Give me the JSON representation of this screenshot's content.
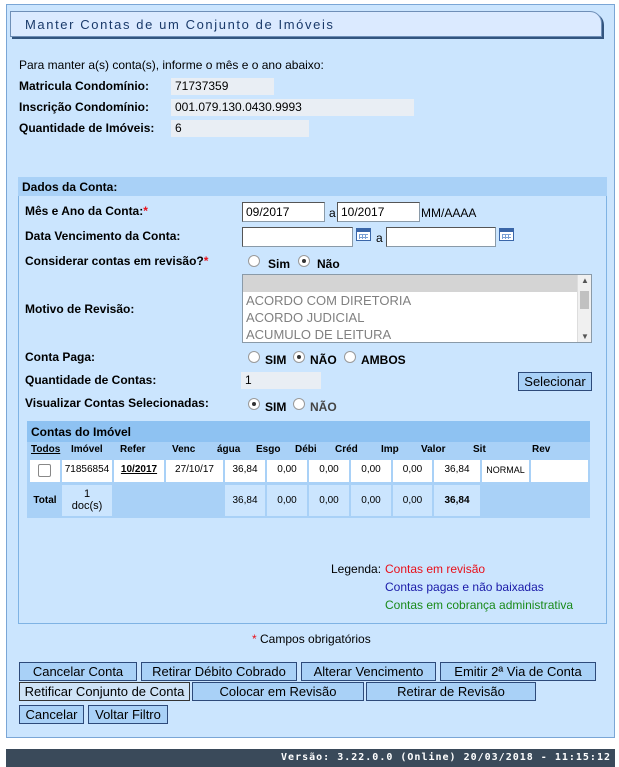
{
  "title": "Manter Contas de um Conjunto de Imóveis",
  "intro": "Para manter a(s) conta(s), informe o mês e o ano abaixo:",
  "info": {
    "matricula_label": "Matricula Condomínio:",
    "matricula_value": "71737359",
    "inscricao_label": "Inscrição Condomínio:",
    "inscricao_value": "001.079.130.0430.9993",
    "qtd_imoveis_label": "Quantidade de Imóveis:",
    "qtd_imoveis_value": "6"
  },
  "dados": {
    "header": "Dados da Conta:",
    "mes_ano_label": "Mês e Ano da Conta:",
    "mes_ano_from": "09/2017",
    "mes_ano_sep": "a",
    "mes_ano_to": "10/2017",
    "mes_ano_format": "MM/AAAA",
    "venc_label": "Data Vencimento da Conta:",
    "venc_sep": "a",
    "revisao_label": "Considerar contas em revisão?",
    "revisao_options": [
      "Sim",
      "Não"
    ],
    "revisao_selected": "Não",
    "motivo_label": "Motivo de Revisão:",
    "motivo_options": [
      "ACORDO COM DIRETORIA",
      "ACORDO JUDICIAL",
      "ACUMULO DE LEITURA"
    ],
    "paga_label": "Conta Paga:",
    "paga_options": [
      "SIM",
      "NÃO",
      "AMBOS"
    ],
    "paga_selected": "NÃO",
    "qtd_contas_label": "Quantidade de Contas:",
    "qtd_contas_value": "1",
    "selecionar_button": "Selecionar",
    "visualizar_label": "Visualizar Contas Selecionadas:",
    "visualizar_options": [
      "SIM",
      "NÃO"
    ],
    "visualizar_selected": "SIM",
    "required_mark": "*"
  },
  "contas": {
    "header": "Contas do Imóvel",
    "columns": [
      "Todos",
      "Imóvel",
      "Refer",
      "Venc",
      "água",
      "Esgo",
      "Débi",
      "Créd",
      "Imp",
      "Valor",
      "Sit",
      "Rev"
    ],
    "row": {
      "imovel": "71856854",
      "refer": "10/2017",
      "venc": "27/10/17",
      "agua": "36,84",
      "esgo": "0,00",
      "debi": "0,00",
      "cred": "0,00",
      "imp": "0,00",
      "valor": "36,84",
      "sit": "NORMAL",
      "rev": ""
    },
    "total": {
      "label": "Total",
      "docs_count": "1",
      "docs_unit": "doc(s)",
      "agua": "36,84",
      "esgo": "0,00",
      "debi": "0,00",
      "cred": "0,00",
      "imp": "0,00",
      "valor": "36,84"
    }
  },
  "legenda": {
    "label": "Legenda:",
    "items": [
      {
        "text": "Contas em revisão",
        "color": "#e8101a"
      },
      {
        "text": "Contas pagas e não baixadas",
        "color": "#1a1aa8"
      },
      {
        "text": "Contas em cobrança administrativa",
        "color": "#1a8a1a"
      }
    ]
  },
  "campos_obrigatorios": "Campos obrigatórios",
  "buttons": {
    "cancelar_conta": "Cancelar Conta",
    "retirar_debito": "Retirar Débito Cobrado",
    "alterar_venc": "Alterar Vencimento",
    "emitir_2via": "Emitir 2ª Via de Conta",
    "retificar": "Retificar Conjunto de Conta",
    "colocar_revisao": "Colocar em Revisão",
    "retirar_revisao": "Retirar de Revisão",
    "cancelar": "Cancelar",
    "voltar_filtro": "Voltar Filtro"
  },
  "footer": "Versão: 3.22.0.0 (Online) 20/03/2018 - 11:15:12",
  "colors": {
    "panel": "#cbe5fe",
    "header": "#a9d1f7",
    "required": "#e8101a",
    "footer_bg": "#3a4a5a"
  }
}
